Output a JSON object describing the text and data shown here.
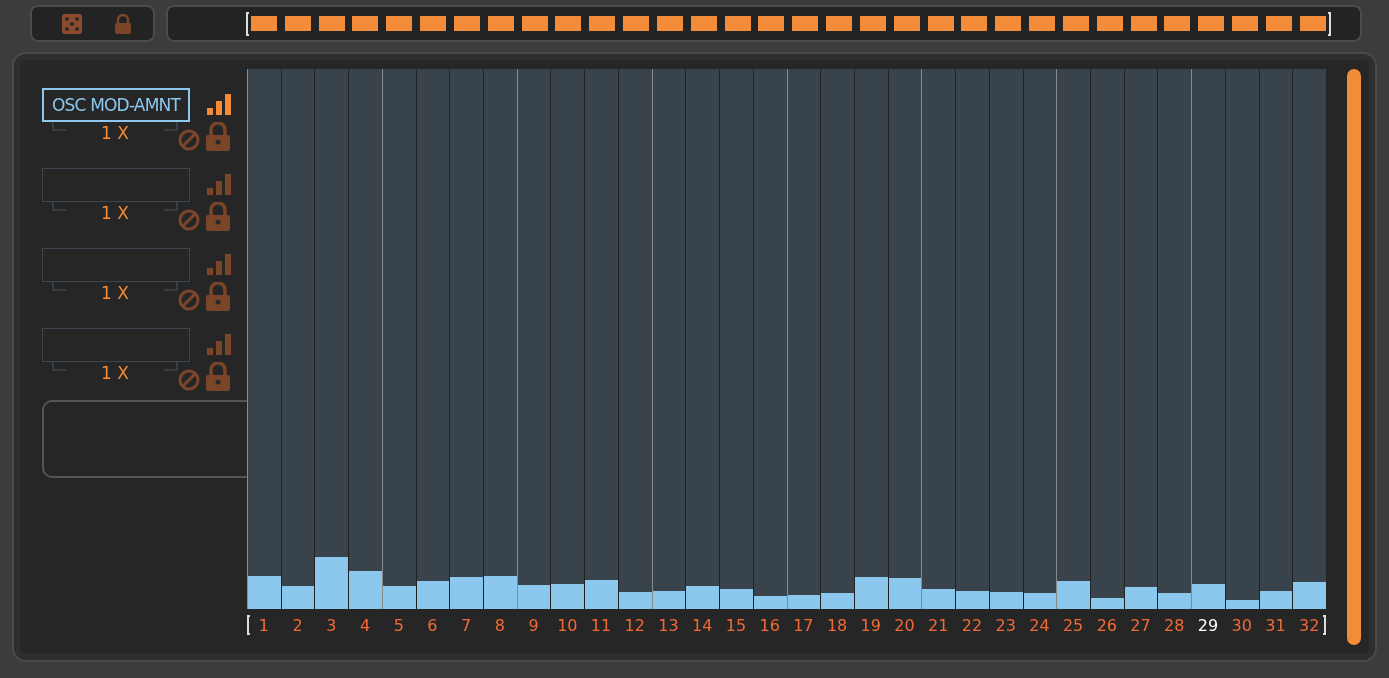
{
  "pattern": [
    {
      "on": true
    },
    {
      "on": true
    },
    {
      "on": true
    },
    {
      "on": true
    },
    {
      "on": true
    },
    {
      "on": true
    },
    {
      "on": true
    },
    {
      "on": true
    },
    {
      "on": true
    },
    {
      "on": true
    },
    {
      "on": true
    },
    {
      "on": true
    },
    {
      "on": true
    },
    {
      "on": true
    },
    {
      "on": true
    },
    {
      "on": true
    },
    {
      "on": true
    },
    {
      "on": true
    },
    {
      "on": true
    },
    {
      "on": true
    },
    {
      "on": true
    },
    {
      "on": true
    },
    {
      "on": true
    },
    {
      "on": true
    },
    {
      "on": true
    },
    {
      "on": true
    },
    {
      "on": true
    },
    {
      "on": true
    },
    {
      "on": true
    },
    {
      "on": true
    },
    {
      "on": true
    },
    {
      "on": true
    }
  ],
  "lanes": [
    {
      "label": "OSC MOD-AMNT",
      "rate": "1 X",
      "selected": true
    },
    {
      "rate": "1 X",
      "selected": false
    },
    {
      "rate": "1 X",
      "selected": false
    },
    {
      "rate": "1 X",
      "selected": false
    }
  ],
  "steps": [
    {
      "number": "1",
      "level": 0.061,
      "selected": false
    },
    {
      "number": "2",
      "level": 0.043,
      "selected": false
    },
    {
      "number": "3",
      "level": 0.096,
      "selected": false
    },
    {
      "number": "4",
      "level": 0.07,
      "selected": false
    },
    {
      "number": "5",
      "level": 0.043,
      "selected": false
    },
    {
      "number": "6",
      "level": 0.052,
      "selected": false
    },
    {
      "number": "7",
      "level": 0.059,
      "selected": false
    },
    {
      "number": "8",
      "level": 0.061,
      "selected": false
    },
    {
      "number": "9",
      "level": 0.044,
      "selected": false
    },
    {
      "number": "10",
      "level": 0.046,
      "selected": false
    },
    {
      "number": "11",
      "level": 0.054,
      "selected": false
    },
    {
      "number": "12",
      "level": 0.031,
      "selected": false
    },
    {
      "number": "13",
      "level": 0.033,
      "selected": false
    },
    {
      "number": "14",
      "level": 0.043,
      "selected": false
    },
    {
      "number": "15",
      "level": 0.037,
      "selected": false
    },
    {
      "number": "16",
      "level": 0.024,
      "selected": false
    },
    {
      "number": "17",
      "level": 0.026,
      "selected": false
    },
    {
      "number": "18",
      "level": 0.03,
      "selected": false
    },
    {
      "number": "19",
      "level": 0.059,
      "selected": false
    },
    {
      "number": "20",
      "level": 0.057,
      "selected": false
    },
    {
      "number": "21",
      "level": 0.037,
      "selected": false
    },
    {
      "number": "22",
      "level": 0.033,
      "selected": false
    },
    {
      "number": "23",
      "level": 0.031,
      "selected": false
    },
    {
      "number": "24",
      "level": 0.03,
      "selected": false
    },
    {
      "number": "25",
      "level": 0.052,
      "selected": false
    },
    {
      "number": "26",
      "level": 0.02,
      "selected": false
    },
    {
      "number": "27",
      "level": 0.041,
      "selected": false
    },
    {
      "number": "28",
      "level": 0.03,
      "selected": false
    },
    {
      "number": "29",
      "level": 0.046,
      "selected": true
    },
    {
      "number": "30",
      "level": 0.017,
      "selected": false
    },
    {
      "number": "31",
      "level": 0.033,
      "selected": false
    },
    {
      "number": "32",
      "level": 0.05,
      "selected": false
    }
  ]
}
